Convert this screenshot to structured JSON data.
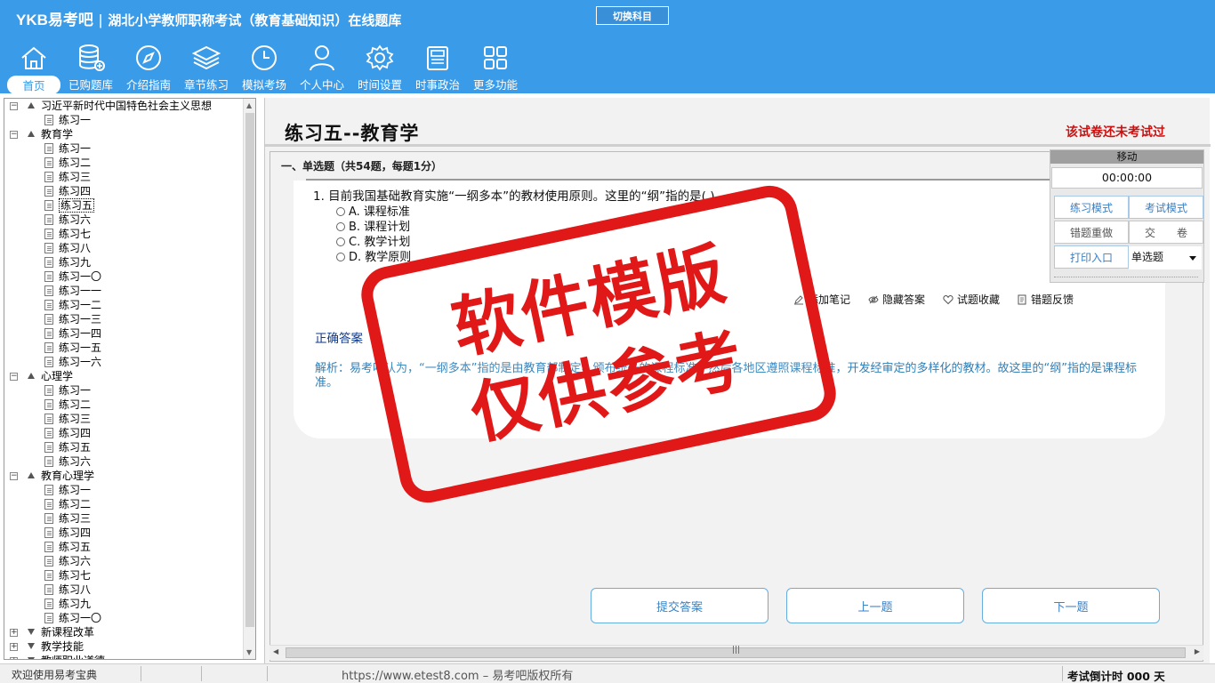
{
  "app": {
    "logo": "YKB易考吧",
    "title": "湖北小学教师职称考试（教育基础知识）在线题库",
    "switch_subject": "切换科目"
  },
  "nav": [
    {
      "label": "首页",
      "icon": "home-icon",
      "active": true
    },
    {
      "label": "已购题库",
      "icon": "database-icon"
    },
    {
      "label": "介绍指南",
      "icon": "compass-icon"
    },
    {
      "label": "章节练习",
      "icon": "layers-icon"
    },
    {
      "label": "模拟考场",
      "icon": "clock-icon"
    },
    {
      "label": "个人中心",
      "icon": "user-icon"
    },
    {
      "label": "时间设置",
      "icon": "gear-icon"
    },
    {
      "label": "时事政治",
      "icon": "newspaper-icon"
    },
    {
      "label": "更多功能",
      "icon": "grid-icon"
    }
  ],
  "tree": [
    {
      "type": "folder",
      "label": "习近平新时代中国特色社会主义思想",
      "expanded": true,
      "children": [
        "练习一"
      ]
    },
    {
      "type": "folder",
      "label": "教育学",
      "expanded": true,
      "children": [
        "练习一",
        "练习二",
        "练习三",
        "练习四",
        "练习五",
        "练习六",
        "练习七",
        "练习八",
        "练习九",
        "练习一〇",
        "练习一一",
        "练习一二",
        "练习一三",
        "练习一四",
        "练习一五",
        "练习一六"
      ],
      "selected": "练习五"
    },
    {
      "type": "folder",
      "label": "心理学",
      "expanded": true,
      "children": [
        "练习一",
        "练习二",
        "练习三",
        "练习四",
        "练习五",
        "练习六"
      ]
    },
    {
      "type": "folder",
      "label": "教育心理学",
      "expanded": true,
      "children": [
        "练习一",
        "练习二",
        "练习三",
        "练习四",
        "练习五",
        "练习六",
        "练习七",
        "练习八",
        "练习九",
        "练习一〇"
      ]
    },
    {
      "type": "folder",
      "label": "新课程改革",
      "expanded": false,
      "children": []
    },
    {
      "type": "folder",
      "label": "教学技能",
      "expanded": false,
      "children": []
    },
    {
      "type": "folder",
      "label": "教师职业道德",
      "expanded": false,
      "children": []
    }
  ],
  "content": {
    "page_title": "练习五--教育学",
    "not_taken": "该试卷还未考试过",
    "section_head": "一、单选题（共54题，每题1分）",
    "question": "1. 目前我国基础教育实施“一纲多本”的教材使用原则。这里的“纲”指的是(  )",
    "options": [
      "A. 课程标准",
      "B. 课程计划",
      "C. 教学计划",
      "D. 教学原则"
    ],
    "tools": [
      "添加笔记",
      "隐藏答案",
      "试题收藏",
      "错题反馈"
    ],
    "answer_label": "正确答案",
    "analysis": "解析：易考吧认为，“一纲多本”指的是由教育部制定、颁布统一的课程标准，然后各地区遵照课程标准，开发经审定的多样化的教材。故这里的“纲”指的是课程标准。",
    "submit_label": "提交答案",
    "prev_label": "上一题",
    "next_label": "下一题"
  },
  "float_panel": {
    "move": "移动",
    "timer": "00:00:00",
    "practice_mode": "练习模式",
    "exam_mode": "考试模式",
    "redo_wrong": "错题重做",
    "submit_paper": "交　　卷",
    "print": "打印入口",
    "question_type": "单选题"
  },
  "stamp": [
    "软件模版",
    "仅供参考"
  ],
  "status": {
    "welcome": "欢迎使用易考宝典",
    "url": "https://www.etest8.com – 易考吧版权所有",
    "countdown": "考试倒计时 000 天"
  }
}
